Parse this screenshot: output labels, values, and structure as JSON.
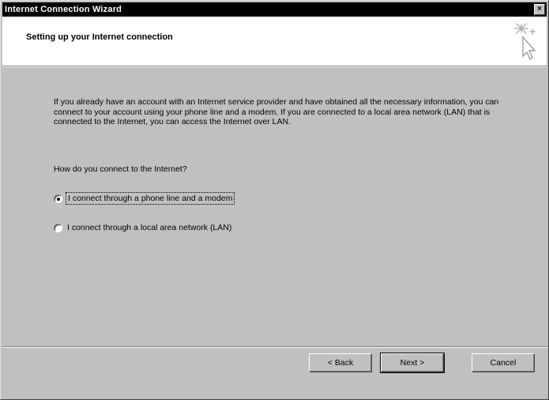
{
  "window": {
    "title": "Internet Connection Wizard",
    "close_label": "×"
  },
  "header": {
    "title": "Setting up your Internet connection"
  },
  "main": {
    "intro": "If you already have an account with an Internet service provider and have obtained all the necessary information, you can connect to your account using your phone line and a modem. If you are connected to a local area network (LAN) that is connected to the Internet, you can access the Internet over LAN.",
    "question": "How do you connect to the Internet?",
    "options": [
      {
        "label": "I connect through a phone line and a modem",
        "selected": true
      },
      {
        "label": "I connect through a local area network (LAN)",
        "selected": false
      }
    ]
  },
  "buttons": {
    "back": "< Back",
    "next": "Next >",
    "cancel": "Cancel"
  },
  "icons": {
    "header_icon": "wizard-sparkle-cursor-icon"
  }
}
